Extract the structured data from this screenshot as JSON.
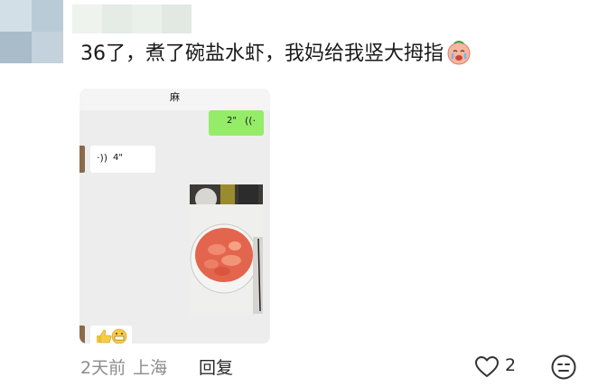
{
  "comment": {
    "text": "36了，煮了碗盐水虾，我妈给我竖大拇指",
    "emoji": "crying-face-emoji"
  },
  "chat_screenshot": {
    "contact_name": "麻",
    "outgoing_voice": {
      "duration": "2\"",
      "icon": "voice-wave-icon"
    },
    "incoming_voice": {
      "duration": "4\"",
      "icon": "voice-wave-icon"
    },
    "photo": "bowl-of-boiled-shrimp-photo",
    "reply_emoji": "👍😁"
  },
  "footer": {
    "date": "2天前",
    "location": "上海",
    "reply_label": "回复",
    "like_count": "2",
    "like_icon": "heart-outline-icon",
    "emoji_icon": "meh-face-icon"
  },
  "colors": {
    "text": "#1a1a1a",
    "muted": "#8c8c8c",
    "wechat_green": "#95ec69",
    "chat_bg": "#ededed"
  }
}
